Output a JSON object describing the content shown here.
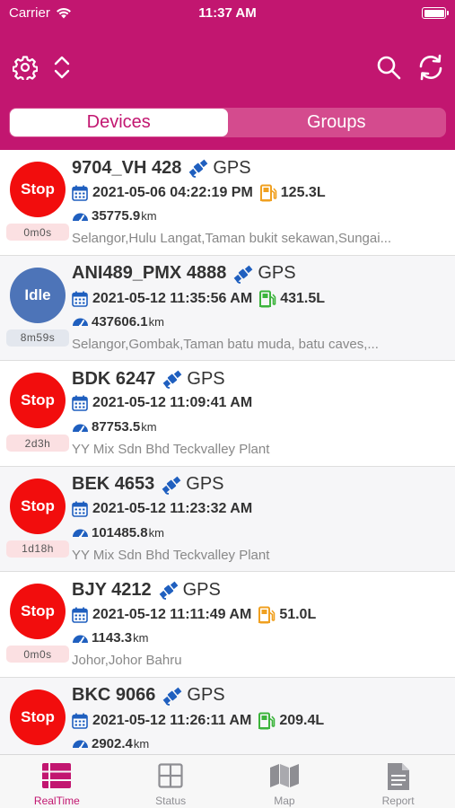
{
  "status_bar": {
    "carrier": "Carrier",
    "time": "11:37 AM"
  },
  "header": {
    "segments": [
      {
        "label": "Devices",
        "active": true
      },
      {
        "label": "Groups",
        "active": false
      }
    ],
    "icons": [
      "gear-icon",
      "sort-icon",
      "search-icon",
      "refresh-icon"
    ]
  },
  "colors": {
    "brand": "#c21670",
    "stop": "#f20d0d",
    "idle": "#4d74b8",
    "fuel_low": "#f0a020",
    "fuel_ok": "#3cb43c",
    "accent_blue": "#1f5fbf"
  },
  "devices": [
    {
      "plate": "9704_VH 428",
      "gps": "GPS",
      "status": "Stop",
      "duration": "0m0s",
      "datetime": "2021-05-06 04:22:19 PM",
      "fuel": "125.3L",
      "fuel_level": "low",
      "mileage": "35775.9",
      "unit": "km",
      "address": "Selangor,Hulu Langat,Taman bukit sekawan,Sungai..."
    },
    {
      "plate": "ANI489_PMX 4888",
      "gps": "GPS",
      "status": "Idle",
      "duration": "8m59s",
      "datetime": "2021-05-12 11:35:56 AM",
      "fuel": "431.5L",
      "fuel_level": "ok",
      "mileage": "437606.1",
      "unit": "km",
      "address": "Selangor,Gombak,Taman batu muda, batu caves,..."
    },
    {
      "plate": "BDK 6247",
      "gps": "GPS",
      "status": "Stop",
      "duration": "2d3h",
      "datetime": "2021-05-12 11:09:41 AM",
      "fuel": "",
      "fuel_level": "",
      "mileage": "87753.5",
      "unit": "km",
      "address": "YY Mix Sdn Bhd Teckvalley Plant"
    },
    {
      "plate": "BEK 4653",
      "gps": "GPS",
      "status": "Stop",
      "duration": "1d18h",
      "datetime": "2021-05-12 11:23:32 AM",
      "fuel": "",
      "fuel_level": "",
      "mileage": "101485.8",
      "unit": "km",
      "address": "YY Mix Sdn Bhd Teckvalley Plant"
    },
    {
      "plate": "BJY 4212",
      "gps": "GPS",
      "status": "Stop",
      "duration": "0m0s",
      "datetime": "2021-05-12 11:11:49 AM",
      "fuel": "51.0L",
      "fuel_level": "low",
      "mileage": "1143.3",
      "unit": "km",
      "address": "Johor,Johor Bahru"
    },
    {
      "plate": "BKC 9066",
      "gps": "GPS",
      "status": "Stop",
      "duration": "",
      "datetime": "2021-05-12 11:26:11 AM",
      "fuel": "209.4L",
      "fuel_level": "ok",
      "mileage": "2902.4",
      "unit": "km",
      "address": ""
    }
  ],
  "tabs": [
    {
      "label": "RealTime",
      "icon": "list-icon",
      "active": true
    },
    {
      "label": "Status",
      "icon": "grid-icon",
      "active": false
    },
    {
      "label": "Map",
      "icon": "map-icon",
      "active": false
    },
    {
      "label": "Report",
      "icon": "report-icon",
      "active": false
    }
  ]
}
